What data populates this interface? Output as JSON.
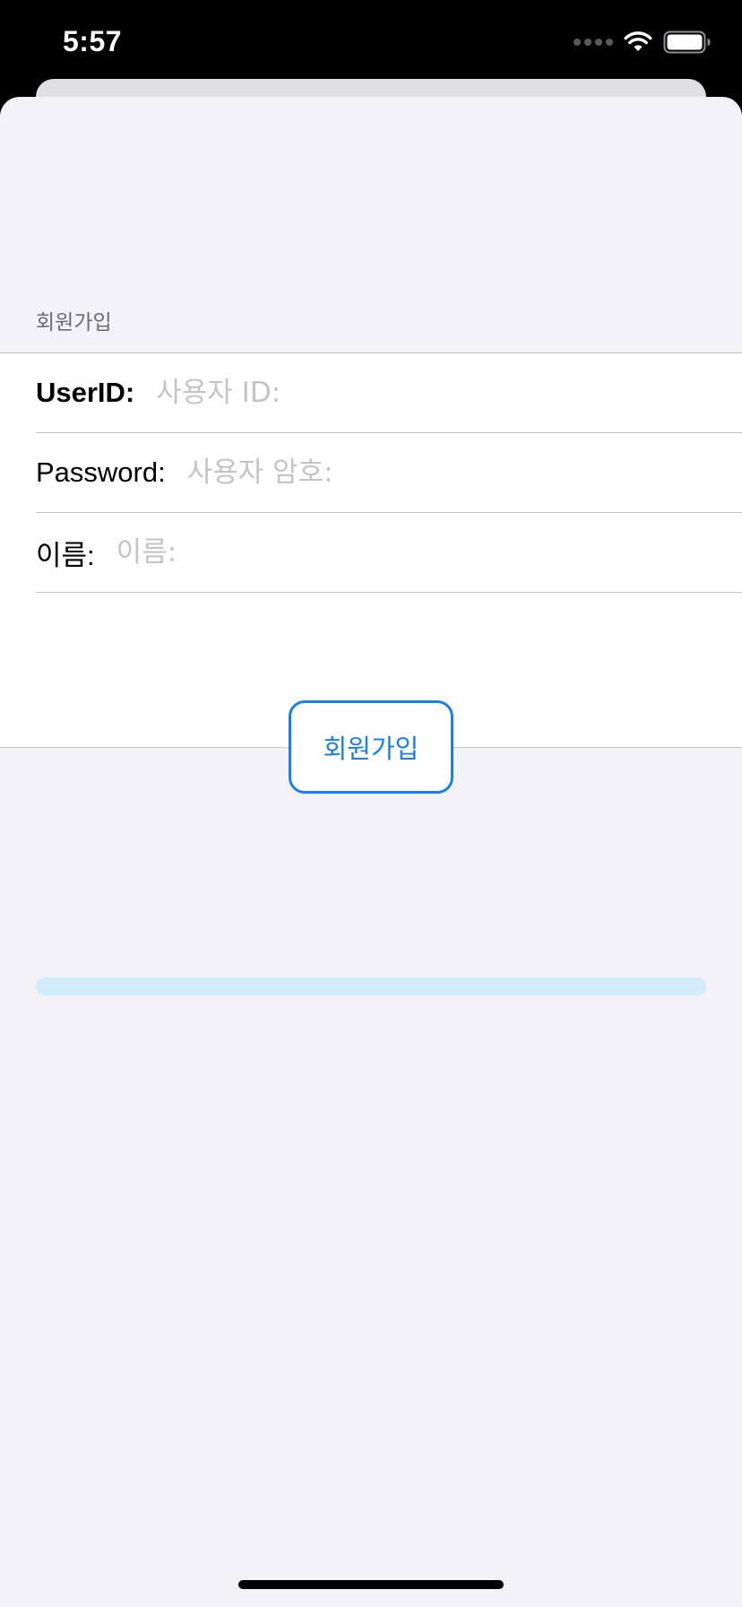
{
  "status_bar": {
    "time": "5:57"
  },
  "form": {
    "section_header": "회원가입",
    "fields": [
      {
        "label": "UserID:",
        "placeholder": "사용자 ID:",
        "value": ""
      },
      {
        "label": "Password:",
        "placeholder": "사용자 암호:",
        "value": ""
      },
      {
        "label": "이름:",
        "placeholder": "이름:",
        "value": ""
      }
    ],
    "submit_label": "회원가입",
    "progress": 0
  },
  "colors": {
    "accent": "#1a7fe8",
    "background": "#f2f2f7",
    "progress_track": "#d2ecfb",
    "placeholder": "#c4c4c6"
  },
  "icons": [
    "cellular-signal-icon",
    "wifi-icon",
    "battery-icon"
  ]
}
